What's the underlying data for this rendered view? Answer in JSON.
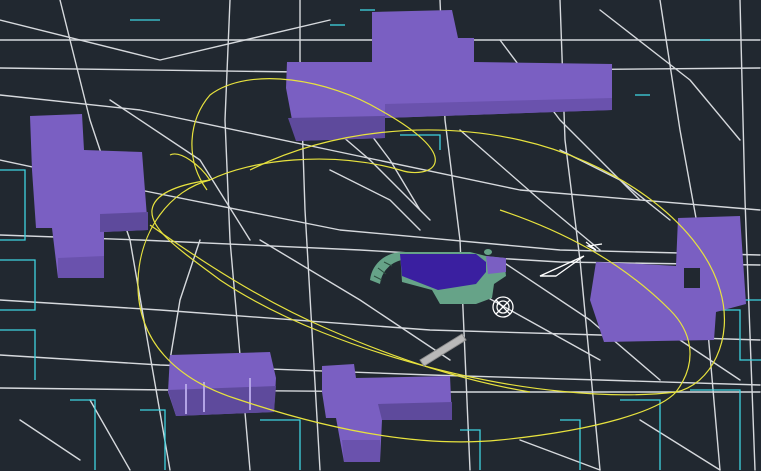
{
  "viewport": {
    "name": "cad-3d-model-viewport",
    "background": "#212830"
  },
  "colors": {
    "street_lines": "#d6d9dd",
    "property_lines": "#3fd3df",
    "building_top": "#7a5fc2",
    "building_side": "#6a52ad",
    "building_front": "#5e4a9c",
    "selected_building": "#3a1fa0",
    "foundation_green": "#66a388",
    "orbit_curve": "#e7e23e",
    "slab_gray": "#b9b9b9",
    "compass": "#ffffff"
  },
  "icons": {
    "north_arrow": "north-arrow-icon",
    "ucs_marker": "ucs-origin-icon"
  }
}
